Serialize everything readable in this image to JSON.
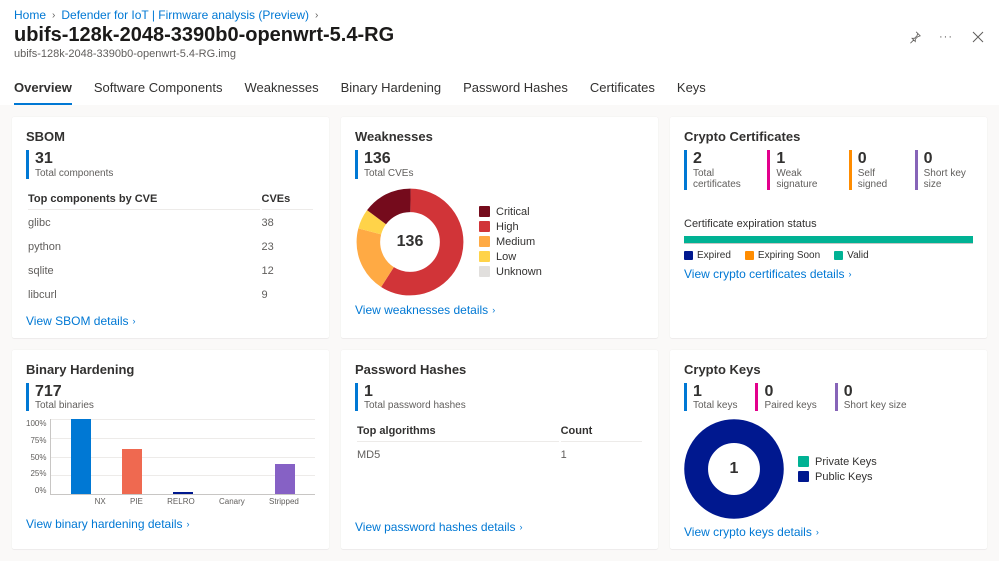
{
  "breadcrumb": {
    "home": "Home",
    "parent": "Defender for IoT | Firmware analysis (Preview)"
  },
  "page_title": "ubifs-128k-2048-3390b0-openwrt-5.4-RG",
  "page_subtitle": "ubifs-128k-2048-3390b0-openwrt-5.4-RG.img",
  "tabs": {
    "overview": "Overview",
    "software": "Software Components",
    "weaknesses": "Weaknesses",
    "binary": "Binary Hardening",
    "password": "Password Hashes",
    "certificates": "Certificates",
    "keys": "Keys"
  },
  "sbom": {
    "title": "SBOM",
    "total_value": "31",
    "total_label": "Total components",
    "col1": "Top components by CVE",
    "col2": "CVEs",
    "rows": [
      {
        "name": "glibc",
        "cves": "38"
      },
      {
        "name": "python",
        "cves": "23"
      },
      {
        "name": "sqlite",
        "cves": "12"
      },
      {
        "name": "libcurl",
        "cves": "9"
      }
    ],
    "link": "View SBOM details"
  },
  "weaknesses": {
    "title": "Weaknesses",
    "total_value": "136",
    "total_label": "Total CVEs",
    "center": "136",
    "legend": {
      "critical": "Critical",
      "high": "High",
      "medium": "Medium",
      "low": "Low",
      "unknown": "Unknown"
    },
    "link": "View weaknesses details"
  },
  "crypto_certs": {
    "title": "Crypto Certificates",
    "stats": [
      {
        "value": "2",
        "label": "Total certificates",
        "color": "#0078d4"
      },
      {
        "value": "1",
        "label": "Weak signature",
        "color": "#e3008c"
      },
      {
        "value": "0",
        "label": "Self signed",
        "color": "#ff8c00"
      },
      {
        "value": "0",
        "label": "Short key size",
        "color": "#8764b8"
      }
    ],
    "exp_title": "Certificate expiration status",
    "legend": {
      "expired": "Expired",
      "soon": "Expiring Soon",
      "valid": "Valid"
    },
    "link": "View crypto certificates details"
  },
  "binary_hardening": {
    "title": "Binary Hardening",
    "total_value": "717",
    "total_label": "Total binaries",
    "link": "View binary hardening details"
  },
  "password_hashes": {
    "title": "Password Hashes",
    "total_value": "1",
    "total_label": "Total password hashes",
    "col1": "Top algorithms",
    "col2": "Count",
    "rows": [
      {
        "alg": "MD5",
        "count": "1"
      }
    ],
    "link": "View password hashes details"
  },
  "crypto_keys": {
    "title": "Crypto Keys",
    "stats": [
      {
        "value": "1",
        "label": "Total keys",
        "color": "#0078d4"
      },
      {
        "value": "0",
        "label": "Paired keys",
        "color": "#e3008c"
      },
      {
        "value": "0",
        "label": "Short key size",
        "color": "#8764b8"
      }
    ],
    "center": "1",
    "legend": {
      "private": "Private Keys",
      "public": "Public Keys"
    },
    "link": "View crypto keys details"
  },
  "chart_data": [
    {
      "type": "pie",
      "title": "Weaknesses",
      "series": [
        {
          "name": "Critical",
          "value": 14,
          "color": "#750b1c"
        },
        {
          "name": "High",
          "value": 58,
          "color": "#d13438"
        },
        {
          "name": "Medium",
          "value": 20,
          "color": "#ffaa44"
        },
        {
          "name": "Low",
          "value": 6,
          "color": "#ffd349"
        },
        {
          "name": "Unknown",
          "value": 0,
          "color": "#e1dfdd"
        }
      ],
      "center_label": "136"
    },
    {
      "type": "bar",
      "title": "Binary Hardening",
      "categories": [
        "NX",
        "PIE",
        "RELRO",
        "Canary",
        "Stripped"
      ],
      "values": [
        100,
        60,
        3,
        0,
        40
      ],
      "colors": [
        "#0078d4",
        "#ef6950",
        "#00188f",
        "#00b294",
        "#8661c5"
      ],
      "ylabel": "%",
      "ylim": [
        0,
        100
      ],
      "yticks": [
        0,
        25,
        50,
        75,
        100
      ]
    },
    {
      "type": "bar",
      "title": "Certificate expiration status",
      "categories": [
        "Expired",
        "Expiring Soon",
        "Valid"
      ],
      "values": [
        0,
        0,
        2
      ],
      "colors": [
        "#00188f",
        "#ff8c00",
        "#00b294"
      ]
    },
    {
      "type": "pie",
      "title": "Crypto Keys",
      "series": [
        {
          "name": "Private Keys",
          "value": 0,
          "color": "#00b294"
        },
        {
          "name": "Public Keys",
          "value": 1,
          "color": "#00188f"
        }
      ],
      "center_label": "1"
    }
  ]
}
